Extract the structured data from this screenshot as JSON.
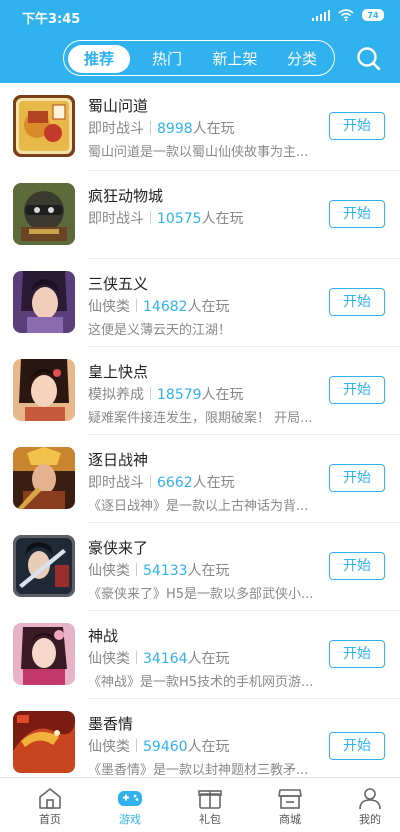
{
  "status_bar": {
    "time": "下午3:45",
    "battery": "74"
  },
  "top_tabs": [
    {
      "label": "推荐",
      "active": true
    },
    {
      "label": "热门",
      "active": false
    },
    {
      "label": "新上架",
      "active": false
    },
    {
      "label": "分类",
      "active": false
    }
  ],
  "games": [
    {
      "name": "蜀山问道",
      "category": "即时战斗",
      "players": "8998",
      "players_suffix": "人在玩",
      "description": "蜀山问道是一款以蜀山仙侠故事为主...",
      "button": "开始"
    },
    {
      "name": "疯狂动物城",
      "category": "即时战斗",
      "players": "10575",
      "players_suffix": "人在玩",
      "description": "",
      "button": "开始"
    },
    {
      "name": "三侠五义",
      "category": "仙侠类",
      "players": "14682",
      "players_suffix": "人在玩",
      "description": "这便是义薄云天的江湖！",
      "button": "开始"
    },
    {
      "name": "皇上快点",
      "category": "模拟养成",
      "players": "18579",
      "players_suffix": "人在玩",
      "description": "疑难案件接连发生，限期破案！ 开局...",
      "button": "开始"
    },
    {
      "name": "逐日战神",
      "category": "即时战斗",
      "players": "6662",
      "players_suffix": "人在玩",
      "description": "《逐日战神》是一款以上古神话为背...",
      "button": "开始"
    },
    {
      "name": "豪侠来了",
      "category": "仙侠类",
      "players": "54133",
      "players_suffix": "人在玩",
      "description": "《豪侠来了》H5是一款以多部武侠小...",
      "button": "开始"
    },
    {
      "name": "神战",
      "category": "仙侠类",
      "players": "34164",
      "players_suffix": "人在玩",
      "description": "《神战》是一款H5技术的手机网页游...",
      "button": "开始"
    },
    {
      "name": "墨香情",
      "category": "仙侠类",
      "players": "59460",
      "players_suffix": "人在玩",
      "description": "《墨香情》是一款以封神题材三教矛...",
      "button": "开始"
    }
  ],
  "bottom_nav": [
    {
      "label": "首页",
      "icon": "home-icon",
      "active": false
    },
    {
      "label": "游戏",
      "icon": "gamepad-icon",
      "active": true
    },
    {
      "label": "礼包",
      "icon": "gift-icon",
      "active": false
    },
    {
      "label": "商城",
      "icon": "store-icon",
      "active": false
    },
    {
      "label": "我的",
      "icon": "user-icon",
      "active": false
    }
  ],
  "colors": {
    "accent": "#2fb2ee",
    "muted_text": "#888888",
    "divider": "#ececec"
  }
}
